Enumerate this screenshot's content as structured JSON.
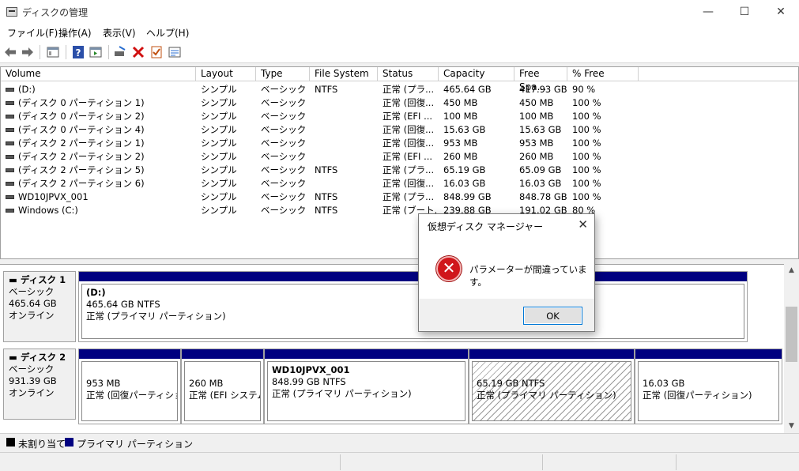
{
  "window": {
    "title": "ディスクの管理",
    "minimize": "—",
    "maximize": "☐",
    "close": "✕"
  },
  "menu": [
    {
      "label": "ファイル(F)"
    },
    {
      "label": "操作(A)"
    },
    {
      "label": "表示(V)"
    },
    {
      "label": "ヘルプ(H)"
    }
  ],
  "toolbar_icons": [
    "back-arrow-icon",
    "forward-arrow-icon",
    "properties-icon",
    "help-icon",
    "console-icon",
    "connect-icon",
    "delete-icon",
    "checklist-icon",
    "properties-list-icon"
  ],
  "columns": [
    "Volume",
    "Layout",
    "Type",
    "File System",
    "Status",
    "Capacity",
    "Free Spa...",
    "% Free"
  ],
  "volumes": [
    {
      "volume": "(D:)",
      "layout": "シンプル",
      "type": "ベーシック",
      "fs": "NTFS",
      "status": "正常 (プラ...",
      "capacity": "465.64 GB",
      "free": "417.93 GB",
      "pct": "90 %"
    },
    {
      "volume": "(ディスク 0 パーティション 1)",
      "layout": "シンプル",
      "type": "ベーシック",
      "fs": "",
      "status": "正常 (回復...",
      "capacity": "450 MB",
      "free": "450 MB",
      "pct": "100 %"
    },
    {
      "volume": "(ディスク 0 パーティション 2)",
      "layout": "シンプル",
      "type": "ベーシック",
      "fs": "",
      "status": "正常 (EFI ...",
      "capacity": "100 MB",
      "free": "100 MB",
      "pct": "100 %"
    },
    {
      "volume": "(ディスク 0 パーティション 4)",
      "layout": "シンプル",
      "type": "ベーシック",
      "fs": "",
      "status": "正常 (回復...",
      "capacity": "15.63 GB",
      "free": "15.63 GB",
      "pct": "100 %"
    },
    {
      "volume": "(ディスク 2 パーティション 1)",
      "layout": "シンプル",
      "type": "ベーシック",
      "fs": "",
      "status": "正常 (回復...",
      "capacity": "953 MB",
      "free": "953 MB",
      "pct": "100 %"
    },
    {
      "volume": "(ディスク 2 パーティション 2)",
      "layout": "シンプル",
      "type": "ベーシック",
      "fs": "",
      "status": "正常 (EFI ...",
      "capacity": "260 MB",
      "free": "260 MB",
      "pct": "100 %"
    },
    {
      "volume": "(ディスク 2 パーティション 5)",
      "layout": "シンプル",
      "type": "ベーシック",
      "fs": "NTFS",
      "status": "正常 (プラ...",
      "capacity": "65.19 GB",
      "free": "65.09 GB",
      "pct": "100 %"
    },
    {
      "volume": "(ディスク 2 パーティション 6)",
      "layout": "シンプル",
      "type": "ベーシック",
      "fs": "",
      "status": "正常 (回復...",
      "capacity": "16.03 GB",
      "free": "16.03 GB",
      "pct": "100 %"
    },
    {
      "volume": "WD10JPVX_001",
      "layout": "シンプル",
      "type": "ベーシック",
      "fs": "NTFS",
      "status": "正常 (プラ...",
      "capacity": "848.99 GB",
      "free": "848.78 GB",
      "pct": "100 %"
    },
    {
      "volume": "Windows (C:)",
      "layout": "シンプル",
      "type": "ベーシック",
      "fs": "NTFS",
      "status": "正常 (ブート...",
      "capacity": "239.88 GB",
      "free": "191.02 GB",
      "pct": "80 %"
    }
  ],
  "disks": [
    {
      "name": "ディスク 1",
      "kind": "ベーシック",
      "size": "465.64 GB",
      "state": "オンライン",
      "partitions": [
        {
          "title": "(D:)",
          "detail": "465.64 GB NTFS",
          "status": "正常 (プライマリ パーティション)"
        }
      ]
    },
    {
      "name": "ディスク 2",
      "kind": "ベーシック",
      "size": "931.39 GB",
      "state": "オンライン",
      "partitions": [
        {
          "title": "",
          "detail": "953 MB",
          "status": "正常 (回復パーティション"
        },
        {
          "title": "",
          "detail": "260 MB",
          "status": "正常 (EFI システム"
        },
        {
          "title": "WD10JPVX_001",
          "detail": "848.99 GB NTFS",
          "status": "正常 (プライマリ パーティション)"
        },
        {
          "title": "",
          "detail": "65.19 GB NTFS",
          "status": "正常 (プライマリ パーティション)"
        },
        {
          "title": "",
          "detail": "16.03 GB",
          "status": "正常 (回復パーティション)"
        }
      ]
    }
  ],
  "legend": [
    {
      "label": "未割り当て",
      "color": "#000000"
    },
    {
      "label": "プライマリ パーティション",
      "color": "#000080"
    }
  ],
  "dialog": {
    "title": "仮想ディスク マネージャー",
    "message": "パラメーターが間違っています。",
    "ok": "OK",
    "close": "✕",
    "icon_glyph": "✕"
  },
  "colors": {
    "partition_bar": "#000080",
    "accent": "#0078d7",
    "error": "#d0161b"
  }
}
